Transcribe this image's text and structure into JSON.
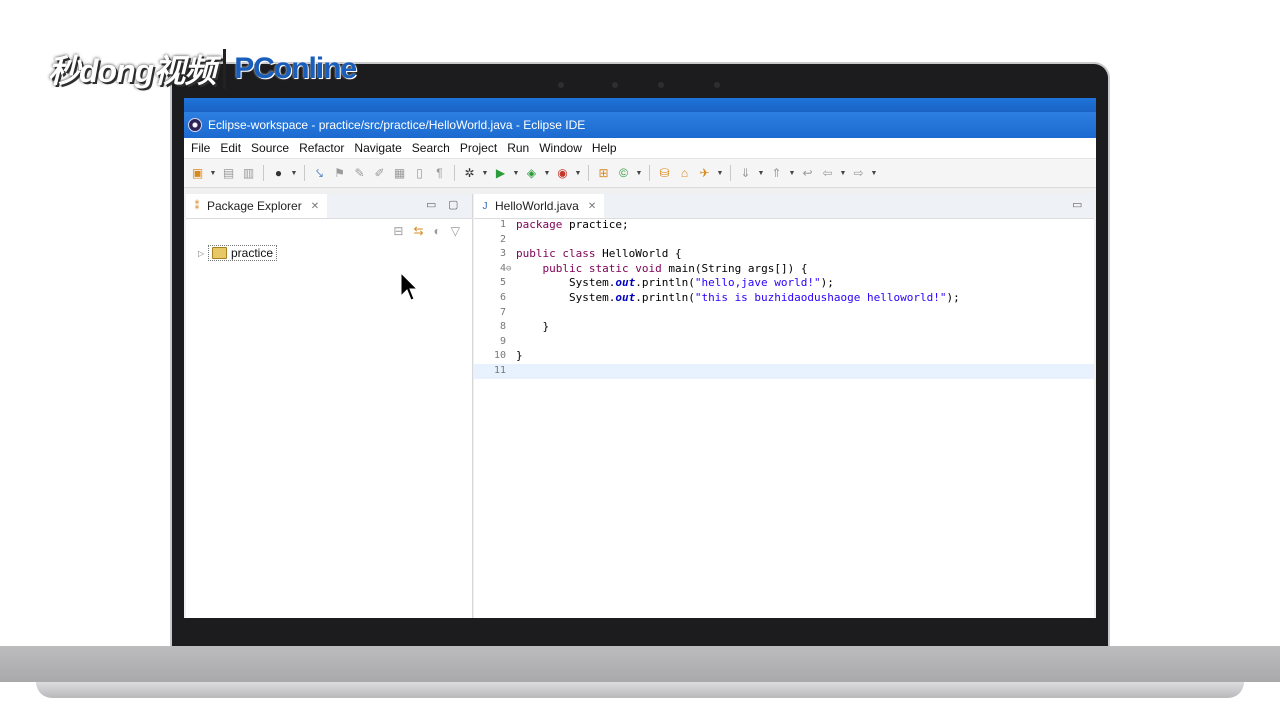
{
  "watermark": {
    "brand_cn": "秒dong视频",
    "brand_pc": "PConline"
  },
  "window": {
    "title": "Eclipse-workspace - practice/src/practice/HelloWorld.java - Eclipse IDE"
  },
  "menu": [
    "File",
    "Edit",
    "Source",
    "Refactor",
    "Navigate",
    "Search",
    "Project",
    "Run",
    "Window",
    "Help"
  ],
  "package_explorer": {
    "tab_label": "Package Explorer",
    "tree": [
      {
        "label": "practice"
      }
    ]
  },
  "editor": {
    "tab_label": "HelloWorld.java",
    "lines": [
      {
        "n": "1",
        "text": "package practice;"
      },
      {
        "n": "2",
        "text": ""
      },
      {
        "n": "3",
        "text": "public class HelloWorld {"
      },
      {
        "n": "4",
        "text": "    public static void main(String args[]) {"
      },
      {
        "n": "5",
        "text": "        System.out.println(\"hello,jave world!\");"
      },
      {
        "n": "6",
        "text": "        System.out.println(\"this is buzhidaodushaoge helloworld!\");"
      },
      {
        "n": "7",
        "text": ""
      },
      {
        "n": "8",
        "text": "    }"
      },
      {
        "n": "9",
        "text": ""
      },
      {
        "n": "10",
        "text": "}"
      },
      {
        "n": "11",
        "text": ""
      }
    ],
    "current_line": "11"
  },
  "colors": {
    "keyword": "#7f0055",
    "string": "#2a00ff",
    "field": "#0000c0",
    "titlebar": "#1c6ad0",
    "current_line_highlight": "#e8f2fe"
  }
}
